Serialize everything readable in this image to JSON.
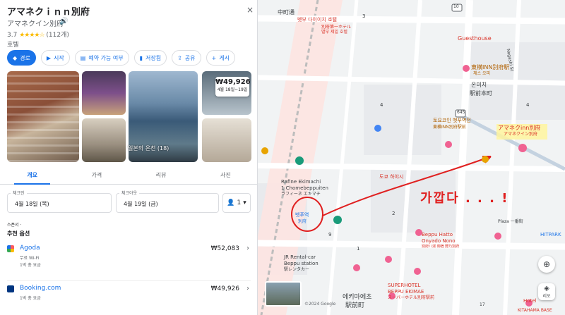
{
  "place": {
    "title": "アマネクｉｎｎ別府",
    "subtitle": "アマネクイン別府",
    "rating": "3.7",
    "stars": "★★★★☆",
    "reviews": "(112개)",
    "category": "호텔",
    "close_icon": "×",
    "speaker_icon": "🔊"
  },
  "actions": [
    {
      "icon": "◆",
      "label": "경로"
    },
    {
      "icon": "▶",
      "label": "시작"
    },
    {
      "icon": "▤",
      "label": "예약 가능 여부"
    },
    {
      "icon": "▮",
      "label": "저장됨"
    },
    {
      "icon": "⇪",
      "label": "공유"
    },
    {
      "icon": "+",
      "label": "게시"
    }
  ],
  "photos": {
    "onsen_label": "일본의 온천 (18)",
    "price_value": "₩49,926",
    "price_dates": "4월 18일~19일"
  },
  "tabs": [
    "개요",
    "가격",
    "리뷰",
    "사진"
  ],
  "booking": {
    "checkin_label": "체크인",
    "checkin_value": "4월 18일 (목)",
    "checkout_label": "체크아웃",
    "checkout_value": "4월 19일 (금)",
    "guests": "1",
    "sponsor": "스폰서 ·",
    "recommended": "추천 옵션"
  },
  "offers": [
    {
      "name": "Agoda",
      "line2": "무료 Wi-Fi",
      "line3": "1박 총 요금",
      "price": "₩52,083",
      "color": "#1a73e8"
    },
    {
      "name": "Booking.com",
      "line2": "1박 총 요금",
      "line3": "",
      "price": "₩49,926",
      "color": "#003580"
    }
  ],
  "map": {
    "labels": {
      "cafe": "벳부 다이이치 호텔",
      "cafe_jp": "別府第一ホテル\n별부 제일 호텔",
      "guesthouse": "Guesthouse",
      "toyoko_top": "東横INN別府駅",
      "chest": "체스 오피",
      "onemichi": "온미치",
      "onemichi2": "駅前本町",
      "toyoko": "토요코인 벳푸역전",
      "toyoko_jp": "東横INN別府駅前",
      "amanek": "アマネクinn別府",
      "amanek_kr": "アマネクイン別府",
      "rafine": "Rafine Ekimachi",
      "rafine2": "1 Chomebeppuiten",
      "rafine_jp": "ラフィーネ エキマチ",
      "beppu_station": "벳푸역",
      "beppu_station_jp": "別府",
      "tokyo": "도쿄 하야시",
      "jr_rent": "JR Rental-car",
      "jr_rent2": "Beppu station",
      "jr_rent_jp": "駅レンタカー",
      "beppu_hatto": "Beppu Hatto",
      "onyado": "Onyado Nono",
      "onyado_jp": "別府八湯 御宿 野乃別府",
      "superhotel": "SUPERHOTEL",
      "superhotel2": "BEPPU EKIMAE",
      "superhotel_jp": "スーパーホテル別府駅前",
      "plaza": "Plaza 一番街",
      "hitpark": "HITPARK",
      "ekimae": "에키마에초",
      "ekimae_jp": "駅前町",
      "kitahama": "KITAHAMA BASE",
      "hotel": "Hotel",
      "annotation": "가깝다 . . . !",
      "street_naka": "中町通",
      "street_nagashi": "Nagashi St",
      "num_645": "645",
      "num_4a": "4",
      "num_4b": "4",
      "num_3": "3",
      "num_2": "2",
      "num_1": "1",
      "num_9": "9",
      "num_10": "10",
      "num_17": "17",
      "copyright": "©2024 Google",
      "rio": "리오"
    },
    "target_icon": "⊕",
    "layers_icon": "◈"
  },
  "colors": {
    "accent": "#1a73e8",
    "annotation": "#e02020",
    "highlight": "#fff59d"
  }
}
